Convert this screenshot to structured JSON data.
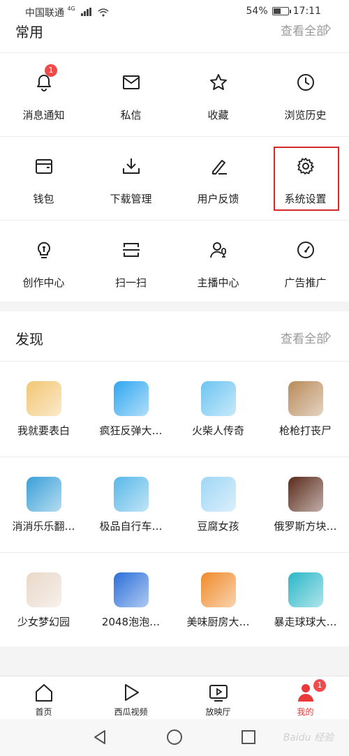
{
  "status_bar": {
    "carrier": "中国联通",
    "network": "4G",
    "battery": "54%",
    "battery_level": 0.54,
    "time": "17:11"
  },
  "common": {
    "title": "常用",
    "see_all": "查看全部",
    "rows": [
      [
        {
          "label": "消息通知",
          "icon": "bell-icon",
          "badge": "1"
        },
        {
          "label": "私信",
          "icon": "mail-icon"
        },
        {
          "label": "收藏",
          "icon": "star-icon"
        },
        {
          "label": "浏览历史",
          "icon": "clock-icon"
        }
      ],
      [
        {
          "label": "钱包",
          "icon": "wallet-icon"
        },
        {
          "label": "下载管理",
          "icon": "download-icon"
        },
        {
          "label": "用户反馈",
          "icon": "feedback-icon"
        },
        {
          "label": "系统设置",
          "icon": "gear-icon"
        }
      ],
      [
        {
          "label": "创作中心",
          "icon": "bulb-icon"
        },
        {
          "label": "扫一扫",
          "icon": "scan-icon"
        },
        {
          "label": "主播中心",
          "icon": "anchor-icon"
        },
        {
          "label": "广告推广",
          "icon": "gauge-icon"
        }
      ]
    ]
  },
  "discover": {
    "title": "发现",
    "see_all": "查看全部",
    "rows": [
      [
        {
          "label": "我就要表白",
          "color": "#f3c673"
        },
        {
          "label": "疯狂反弹大…",
          "color": "#2fa7f0"
        },
        {
          "label": "火柴人传奇",
          "color": "#6cc4f1"
        },
        {
          "label": "枪枪打丧尸",
          "color": "#b88a5a"
        }
      ],
      [
        {
          "label": "消消乐乐翻…",
          "color": "#3aa0d8"
        },
        {
          "label": "极品自行车…",
          "color": "#58b8e8"
        },
        {
          "label": "豆腐女孩",
          "color": "#9fd6f6"
        },
        {
          "label": "俄罗斯方块…",
          "color": "#5a2a1a"
        }
      ],
      [
        {
          "label": "少女梦幻园",
          "color": "#e9d8c9"
        },
        {
          "label": "2048泡泡…",
          "color": "#2b6fd9"
        },
        {
          "label": "美味厨房大…",
          "color": "#f08a2a"
        },
        {
          "label": "暴走球球大…",
          "color": "#2bb7c8"
        }
      ]
    ]
  },
  "tabbar": [
    {
      "label": "首页",
      "icon": "home-icon"
    },
    {
      "label": "西瓜视频",
      "icon": "play-icon"
    },
    {
      "label": "放映厅",
      "icon": "tv-icon"
    },
    {
      "label": "我的",
      "icon": "user-icon",
      "badge": "1",
      "active": true
    }
  ],
  "accent_color": "#e8393b",
  "watermark": "Baidu 经验"
}
